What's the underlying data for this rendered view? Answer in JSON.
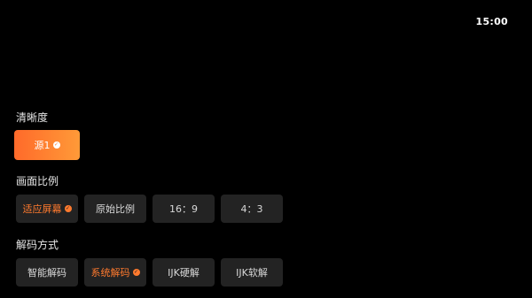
{
  "status_bar": {
    "time": "15:00"
  },
  "sections": {
    "quality": {
      "title": "清晰度",
      "options": [
        {
          "label": "源1",
          "selected": true
        }
      ]
    },
    "aspect": {
      "title": "画面比例",
      "options": [
        {
          "label": "适应屏幕",
          "selected": true
        },
        {
          "label": "原始比例",
          "selected": false
        },
        {
          "label": "16：9",
          "selected": false
        },
        {
          "label": "4：3",
          "selected": false
        }
      ]
    },
    "decoder": {
      "title": "解码方式",
      "options": [
        {
          "label": "智能解码",
          "selected": false
        },
        {
          "label": "系统解码",
          "selected": true
        },
        {
          "label": "IJK硬解",
          "selected": false
        },
        {
          "label": "IJK软解",
          "selected": false
        }
      ]
    }
  },
  "icons": {
    "check": "check-circle-icon"
  },
  "colors": {
    "accent": "#ff7a2e",
    "accent_gradient_start": "#ff6a2a",
    "accent_gradient_end": "#ff9a38",
    "button_bg": "#232323",
    "background": "#000000"
  }
}
